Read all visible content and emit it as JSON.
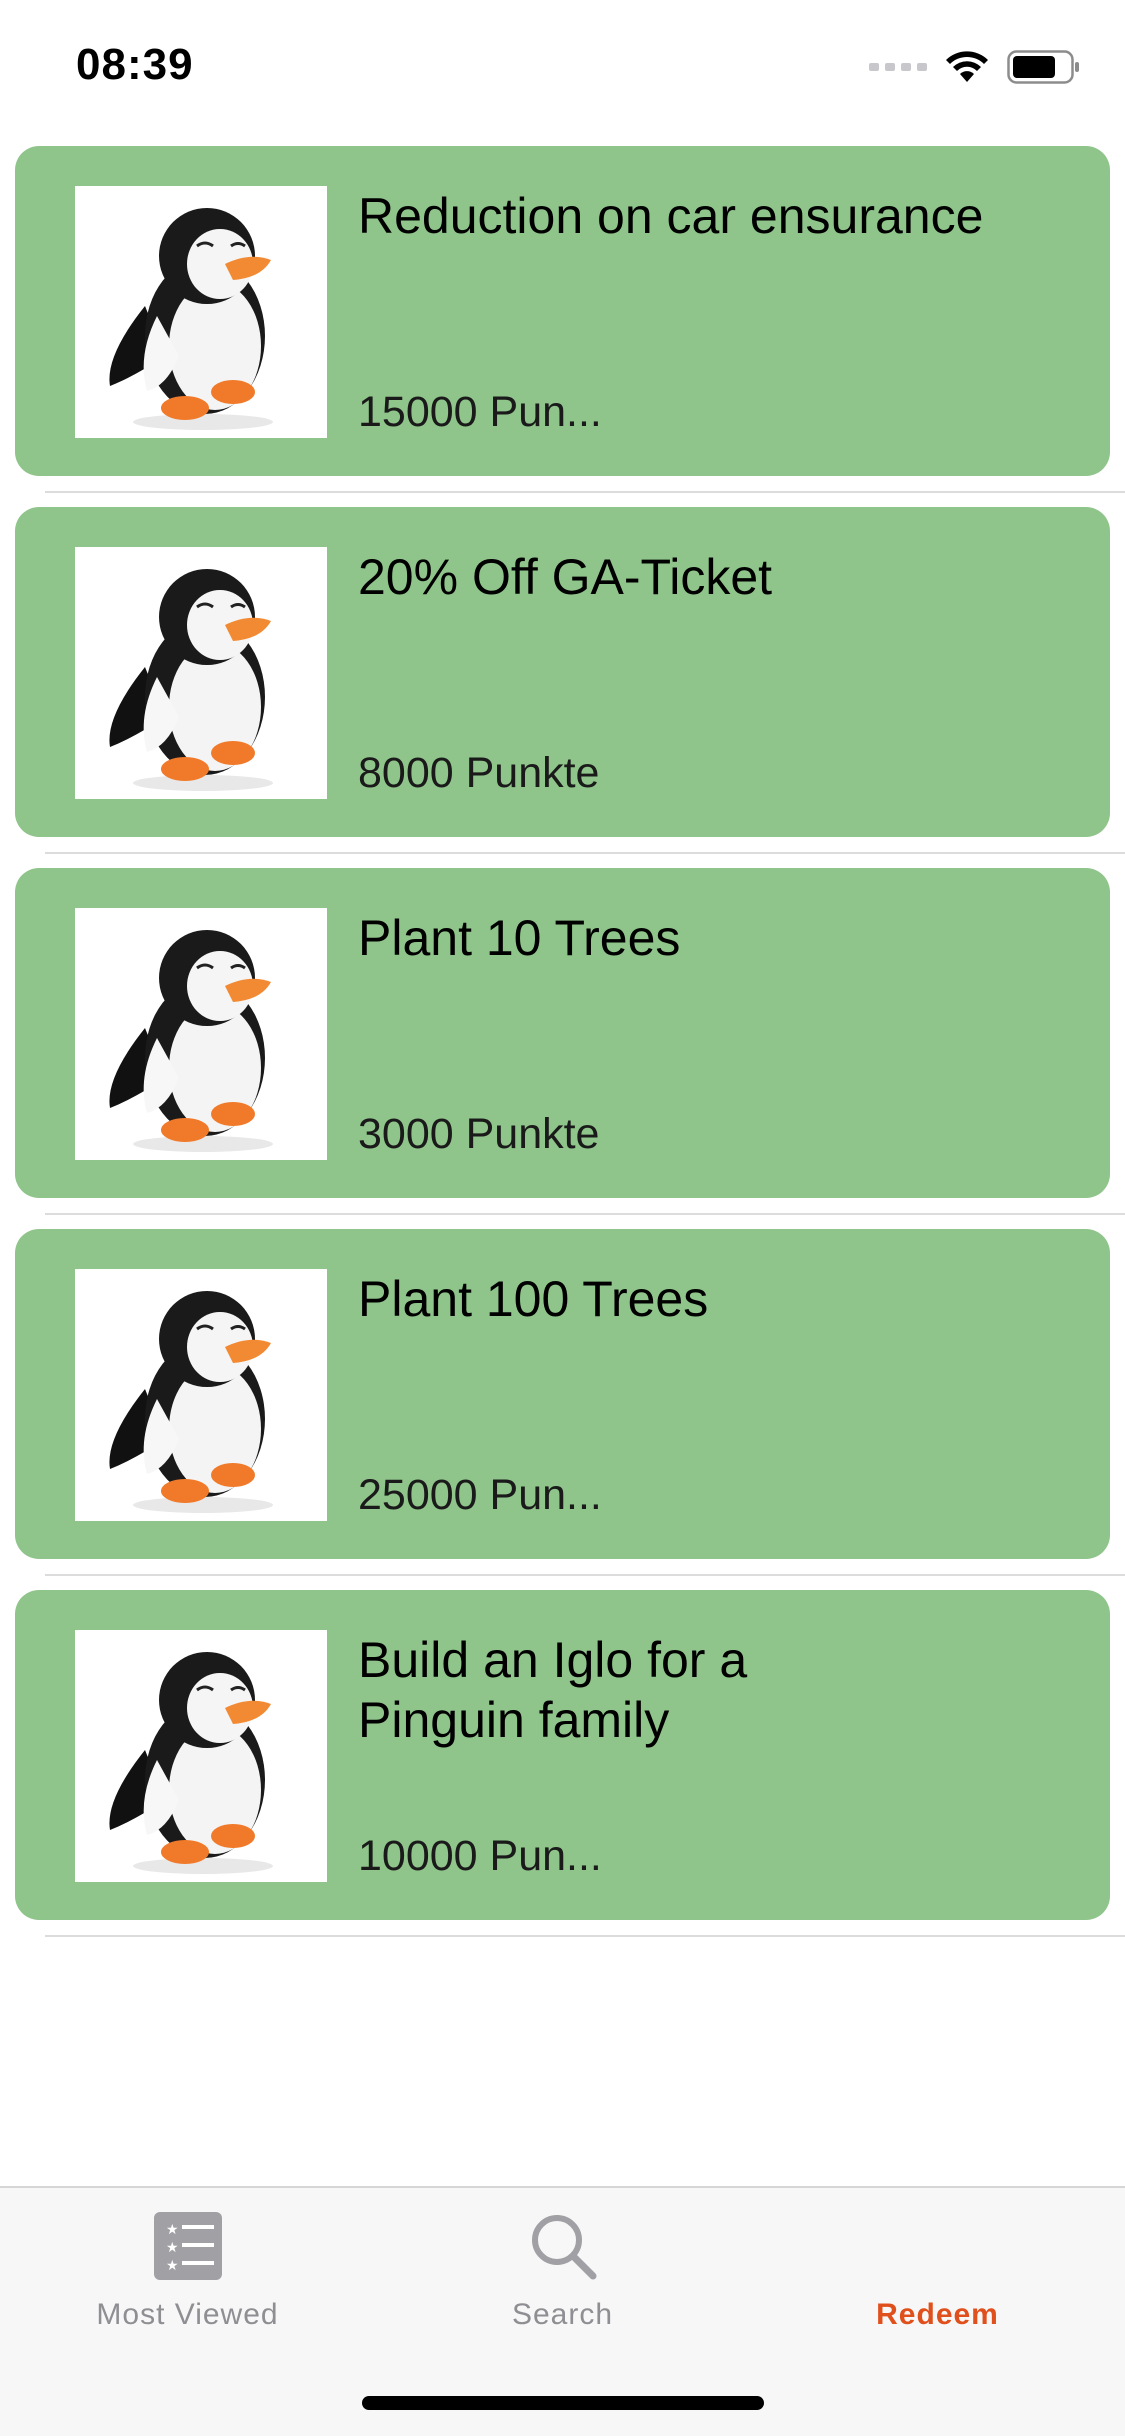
{
  "status_bar": {
    "time": "08:39"
  },
  "rewards": [
    {
      "title": "Reduction on car ensurance",
      "points": "15000 Pun..."
    },
    {
      "title": "20% Off GA-Ticket",
      "points": "8000 Punkte"
    },
    {
      "title": "Plant 10 Trees",
      "points": "3000 Punkte"
    },
    {
      "title": "Plant 100 Trees",
      "points": "25000 Pun..."
    },
    {
      "title": "Build an Iglo for a Pinguin family",
      "points": "10000 Pun..."
    }
  ],
  "tab_bar": {
    "tabs": [
      {
        "label": "Most Viewed",
        "icon": "most-viewed-list-icon",
        "active": false
      },
      {
        "label": "Search",
        "icon": "search-icon",
        "active": false
      },
      {
        "label": "Redeem",
        "icon": "",
        "active": true
      }
    ]
  },
  "colors": {
    "card_background": "#8fc58a",
    "active_tab": "#e0501c",
    "inactive_tab": "#8e8e93"
  }
}
